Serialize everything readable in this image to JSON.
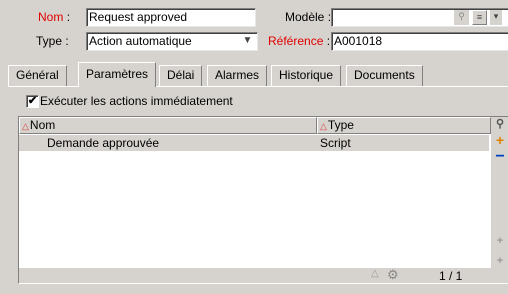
{
  "form": {
    "nom_label": "Nom",
    "nom_value": "Request approved",
    "type_label": "Type",
    "type_value": "Action automatique",
    "modele_label": "Modèle",
    "modele_value": "",
    "reference_label": "Référence",
    "reference_value": "A001018",
    "colon": ":"
  },
  "tabs": [
    {
      "label": "Général"
    },
    {
      "label": "Paramètres"
    },
    {
      "label": "Délai"
    },
    {
      "label": "Alarmes"
    },
    {
      "label": "Historique"
    },
    {
      "label": "Documents"
    }
  ],
  "active_tab": "Paramètres",
  "panel": {
    "checkbox_label": "Exécuter les actions immédiatement",
    "checkbox_checked": true,
    "checkbox_mark": "✔"
  },
  "table": {
    "columns": [
      "Nom",
      "Type"
    ],
    "rows": [
      {
        "nom": "Demande approuvée",
        "type": "Script"
      }
    ],
    "pager": "1 / 1"
  },
  "icons": {
    "search": "search-icon",
    "dropdown": "chevron-down-icon",
    "add": "plus-icon",
    "remove": "minus-icon",
    "sort": "sort-triangle-icon",
    "settings": "gear-icon"
  },
  "colors": {
    "required_label": "#e00000",
    "background": "#d6d3ce",
    "add": "#e08000",
    "remove": "#0040c0"
  }
}
